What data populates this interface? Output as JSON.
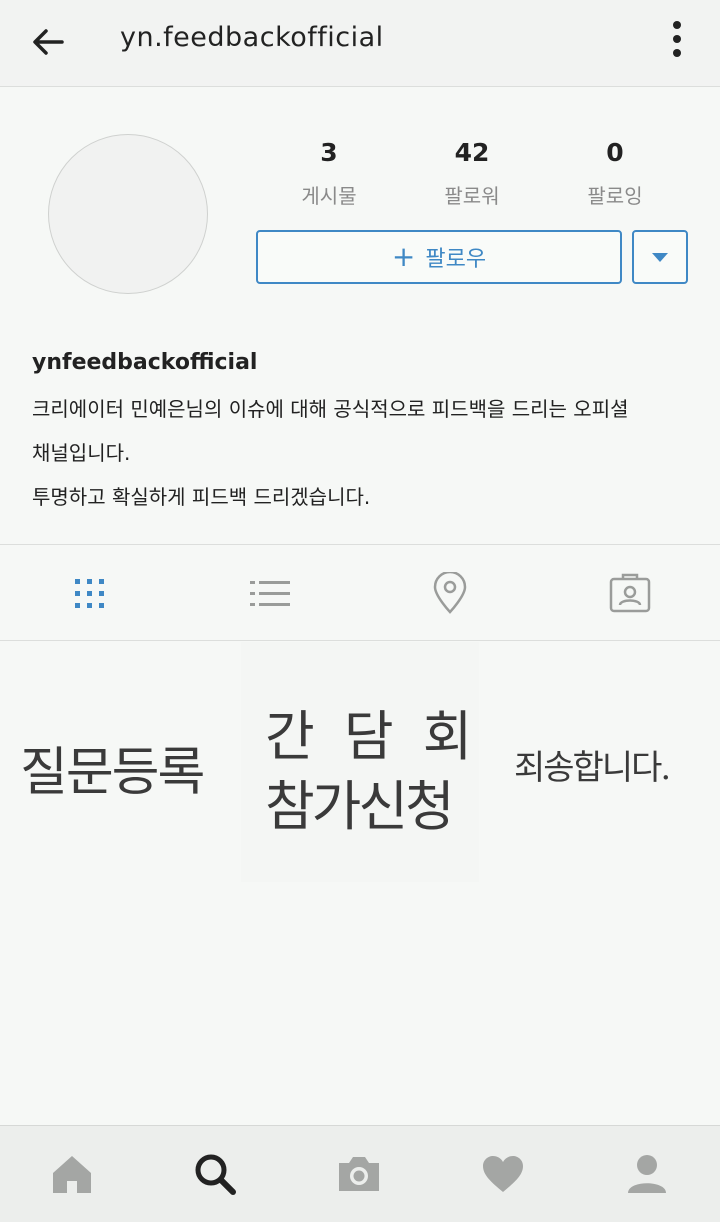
{
  "header": {
    "username": "yn.feedbackofficial",
    "back_icon": "arrow-left-icon",
    "more_icon": "more-vertical-icon"
  },
  "profile": {
    "stats": [
      {
        "value": "3",
        "label": "게시물"
      },
      {
        "value": "42",
        "label": "팔로워"
      },
      {
        "value": "0",
        "label": "팔로잉"
      }
    ],
    "follow_label": "팔로우",
    "follow_plus": "+",
    "name": "ynfeedbackofficial",
    "bio_lines": [
      "크리에이터 민예은님의 이슈에 대해 공식적으로 피드백을 드리는 오피셜",
      "채널입니다.",
      "투명하고 확실하게 피드백 드리겠습니다."
    ],
    "accent_color": "#3f88c5"
  },
  "tabs": [
    "grid-icon",
    "list-icon",
    "location-pin-icon",
    "tagged-person-icon"
  ],
  "posts": [
    {
      "lines": [
        "질문등록"
      ]
    },
    {
      "lines": [
        "간 담 회",
        "참가신청"
      ]
    },
    {
      "lines": [
        "죄송합니다."
      ]
    }
  ],
  "bottom_nav": [
    "home-icon",
    "search-icon",
    "camera-icon",
    "heart-icon",
    "profile-icon"
  ]
}
